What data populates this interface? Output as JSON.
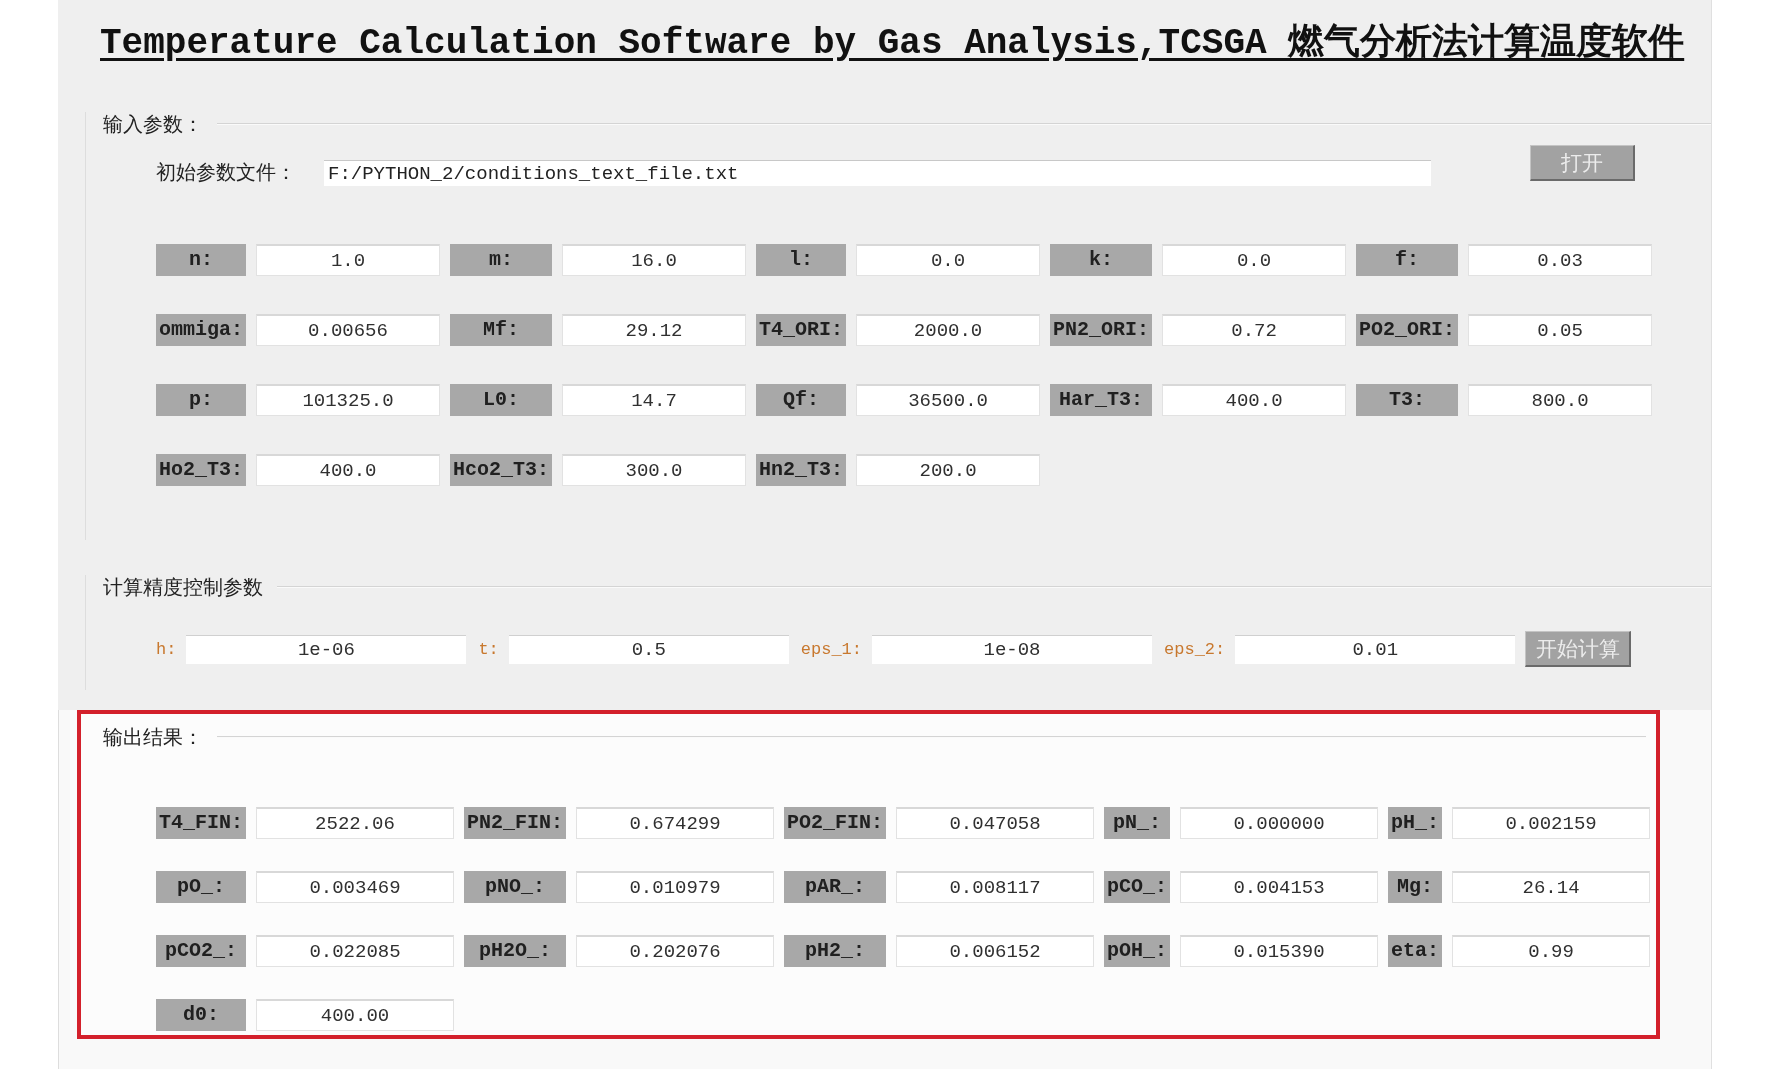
{
  "title": "Temperature Calculation Software by Gas Analysis,TCSGA 燃气分析法计算温度软件",
  "input_parameters": {
    "legend": "输入参数：",
    "file_label": "初始参数文件：",
    "file_path": "F:/PYTHON_2/conditions_text_file.txt",
    "open_button": "打开",
    "rows": [
      [
        {
          "label": "n:",
          "value": "1.0"
        },
        {
          "label": "m:",
          "value": "16.0"
        },
        {
          "label": "l:",
          "value": "0.0"
        },
        {
          "label": "k:",
          "value": "0.0"
        },
        {
          "label": "f:",
          "value": "0.03"
        }
      ],
      [
        {
          "label": "ommiga:",
          "value": "0.00656"
        },
        {
          "label": "Mf:",
          "value": "29.12"
        },
        {
          "label": "T4_ORI:",
          "value": "2000.0"
        },
        {
          "label": "PN2_ORI:",
          "value": "0.72"
        },
        {
          "label": "PO2_ORI:",
          "value": "0.05"
        }
      ],
      [
        {
          "label": "p:",
          "value": "101325.0"
        },
        {
          "label": "L0:",
          "value": "14.7"
        },
        {
          "label": "Qf:",
          "value": "36500.0"
        },
        {
          "label": "Har_T3:",
          "value": "400.0"
        },
        {
          "label": "T3:",
          "value": "800.0"
        }
      ],
      [
        {
          "label": "Ho2_T3:",
          "value": "400.0"
        },
        {
          "label": "Hco2_T3:",
          "value": "300.0"
        },
        {
          "label": "Hn2_T3:",
          "value": "200.0"
        }
      ]
    ]
  },
  "precision": {
    "legend": "计算精度控制参数",
    "fields": [
      {
        "label": "h:",
        "value": "1e-06"
      },
      {
        "label": "t:",
        "value": "0.5"
      },
      {
        "label": "eps_1:",
        "value": "1e-08"
      },
      {
        "label": "eps_2:",
        "value": "0.01"
      }
    ],
    "start_button": "开始计算"
  },
  "output": {
    "legend": "输出结果：",
    "highlighted": true,
    "rows": [
      [
        {
          "label": "T4_FIN:",
          "value": "2522.06"
        },
        {
          "label": "PN2_FIN:",
          "value": "0.674299"
        },
        {
          "label": "PO2_FIN:",
          "value": "0.047058"
        },
        {
          "label": "pN_:",
          "value": "0.000000"
        },
        {
          "label": "pH_:",
          "value": "0.002159"
        }
      ],
      [
        {
          "label": "pO_:",
          "value": "0.003469"
        },
        {
          "label": "pNO_:",
          "value": "0.010979"
        },
        {
          "label": "pAR_:",
          "value": "0.008117"
        },
        {
          "label": "pCO_:",
          "value": "0.004153"
        },
        {
          "label": "Mg:",
          "value": "26.14"
        }
      ],
      [
        {
          "label": "pCO2_:",
          "value": "0.022085"
        },
        {
          "label": "pH2O_:",
          "value": "0.202076"
        },
        {
          "label": "pH2_:",
          "value": "0.006152"
        },
        {
          "label": "pOH_:",
          "value": "0.015390"
        },
        {
          "label": "eta:",
          "value": "0.99"
        }
      ],
      [
        {
          "label": "d0:",
          "value": "400.00"
        }
      ]
    ]
  }
}
